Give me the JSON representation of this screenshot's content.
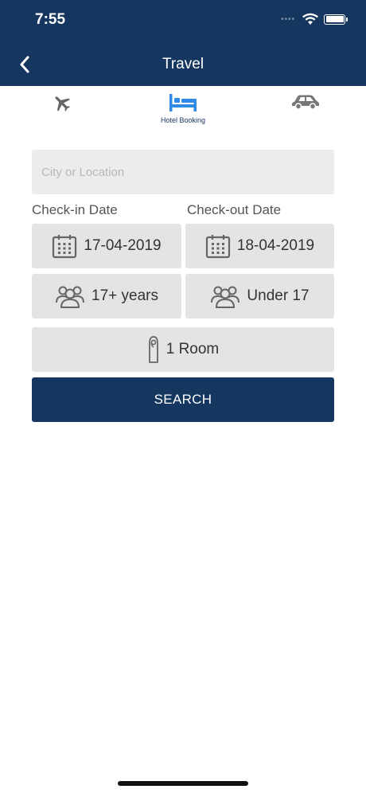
{
  "status": {
    "time": "7:55"
  },
  "header": {
    "title": "Travel"
  },
  "tabs": {
    "hotel_label": "Hotel Booking"
  },
  "form": {
    "city_placeholder": "City or Location",
    "checkin_label": "Check-in Date",
    "checkout_label": "Check-out Date",
    "checkin_value": "17-04-2019",
    "checkout_value": "18-04-2019",
    "adults_value": "17+ years",
    "children_value": "Under 17",
    "rooms_value": "1 Room",
    "search_label": "SEARCH"
  },
  "colors": {
    "header_bg": "#15365f",
    "active_tab": "#2f8be6",
    "field_bg": "#e4e4e4"
  },
  "icons": [
    "back-chevron-icon",
    "airplane-icon",
    "bed-icon",
    "car-icon",
    "calendar-icon",
    "people-icon",
    "door-hanger-icon"
  ]
}
